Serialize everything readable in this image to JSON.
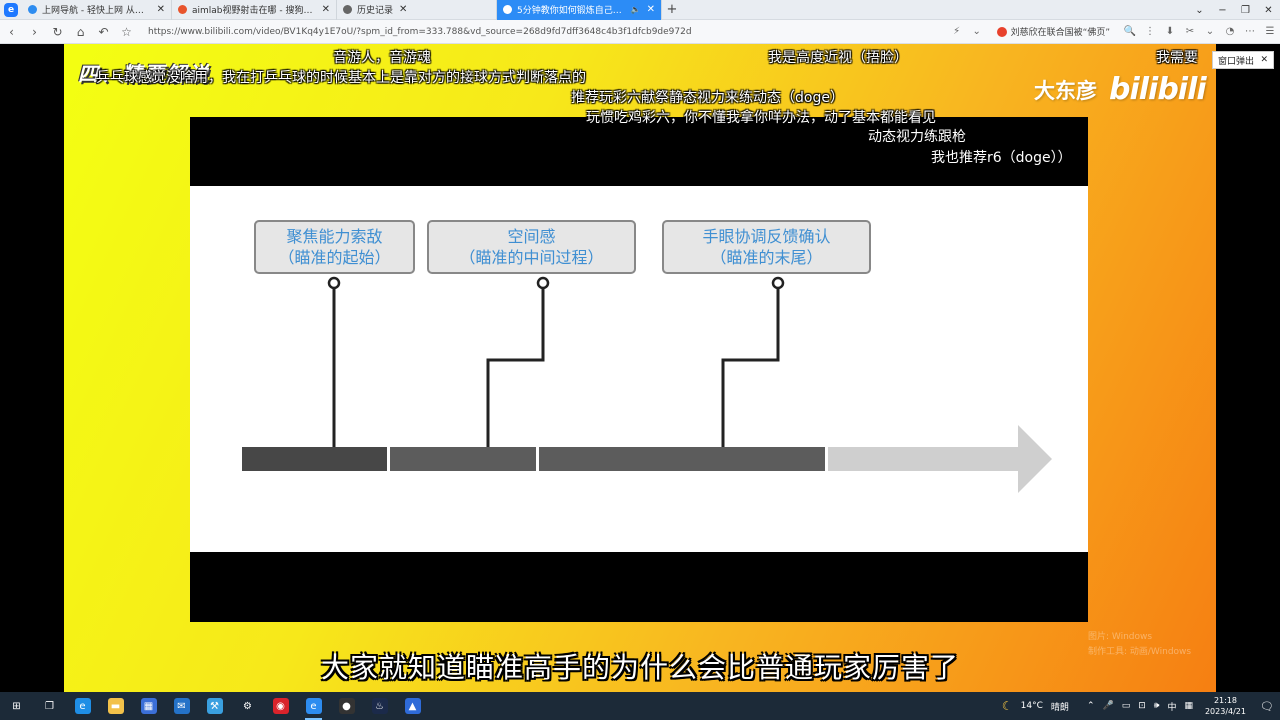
{
  "browser": {
    "logo_glyph": "e",
    "tabs": [
      {
        "label": "上网导航 - 轻快上网 从这里开始",
        "fav_color": "#2d8cf0",
        "width": 150,
        "active": false
      },
      {
        "label": "aimlab视野射击在哪 - 搜狗搜索",
        "fav_color": "#e8542c",
        "width": 165,
        "active": false
      },
      {
        "label": "历史记录",
        "fav_color": "#666666",
        "width": 160,
        "active": false
      },
      {
        "label": "5分钟教你如何锻炼自己的眼睛",
        "fav_color": "#ffffff",
        "width": 165,
        "active": true
      }
    ],
    "new_tab": "+",
    "window_controls": [
      "⌄",
      "−",
      "❐",
      "✕"
    ],
    "nav": {
      "back": "‹",
      "forward": "›",
      "refresh": "↻",
      "home": "⌂",
      "undo": "↶",
      "star": "☆"
    },
    "url": "https://www.bilibili.com/video/BV1Kq4y1E7oU/?spm_id_from=333.788&vd_source=268d9fd7dff3648c4b3f1dfcb9de972d",
    "right_icons": [
      "⚡",
      "⌄"
    ],
    "search_hint": "刘慈欣在联合国被“佛页”",
    "right_tools": [
      "🔍",
      "⋮",
      "⬇",
      "✂",
      "⌄",
      "◔",
      "⋯",
      "☰"
    ]
  },
  "video": {
    "title_overlay": "四、精要解说",
    "brand_name": "大东彦",
    "brand_logo": "bilibili",
    "popup_button": {
      "label": "窗口弹出",
      "close": "✕"
    },
    "diagram": {
      "boxes": [
        {
          "line1": "聚焦能力索敌",
          "line2": "（瞄准的起始）"
        },
        {
          "line1": "空间感",
          "line2": "（瞄准的中间过程）"
        },
        {
          "line1": "手眼协调反馈确认",
          "line2": "（瞄准的末尾）"
        }
      ],
      "bar_color_dark": "#474747",
      "bar_color_mid": "#5c5c5c",
      "arrow_color": "#cfcfcf"
    },
    "danmaku": [
      {
        "text": "音游人，音游魂"
      },
      {
        "text": "我是高度近视（捂脸）"
      },
      {
        "text": "我需要"
      },
      {
        "text": "乒乓球感觉没啥用，我在打乒乓球的时候基本上是靠对方的接球方式判断落点的"
      },
      {
        "text": "推荐玩彩六献祭静态视力来练动态（doge）"
      },
      {
        "text": "玩惯吃鸡彩六，你不懂我拿你咩办法，动了基本都能看见"
      },
      {
        "text": "动态视力练跟枪"
      },
      {
        "text": "我也推荐r6（doge））"
      }
    ],
    "subtitle": "大家就知道瞄准高手的为什么会比普通玩家厉害了",
    "watermark": [
      "图片: Windows",
      "制作工具: 动画/Windows"
    ]
  },
  "taskbar": {
    "icons": [
      {
        "name": "start-icon",
        "glyph": "⊞",
        "bg": "transparent"
      },
      {
        "name": "task-view-icon",
        "glyph": "❐",
        "bg": "transparent"
      },
      {
        "name": "edge-icon",
        "glyph": "e",
        "bg": "#1f8ee6"
      },
      {
        "name": "file-explorer-icon",
        "glyph": "▬",
        "bg": "#f2c14a"
      },
      {
        "name": "store-icon",
        "glyph": "▦",
        "bg": "#3b6fd8"
      },
      {
        "name": "mail-icon",
        "glyph": "✉",
        "bg": "#2472c8"
      },
      {
        "name": "tool-icon",
        "glyph": "⚒",
        "bg": "#3aa0e0"
      },
      {
        "name": "settings-icon",
        "glyph": "⚙",
        "bg": "transparent"
      },
      {
        "name": "netease-music-icon",
        "glyph": "◉",
        "bg": "#d9232b"
      },
      {
        "name": "browser-icon",
        "glyph": "e",
        "bg": "#2d8cf0"
      },
      {
        "name": "record-icon",
        "glyph": "●",
        "bg": "#333333"
      },
      {
        "name": "steam-icon",
        "glyph": "♨",
        "bg": "#1b2a4a"
      },
      {
        "name": "launcher-icon",
        "glyph": "▲",
        "bg": "#2f6bd8"
      }
    ],
    "weather_temp": "14°C",
    "weather_desc": "晴朗",
    "tray_glyphs": [
      "⌃",
      "🎤",
      "▭",
      "⊡",
      "🕪",
      "中",
      "▦"
    ],
    "time": "21:18",
    "date": "2023/4/21",
    "notification": "🗨"
  }
}
